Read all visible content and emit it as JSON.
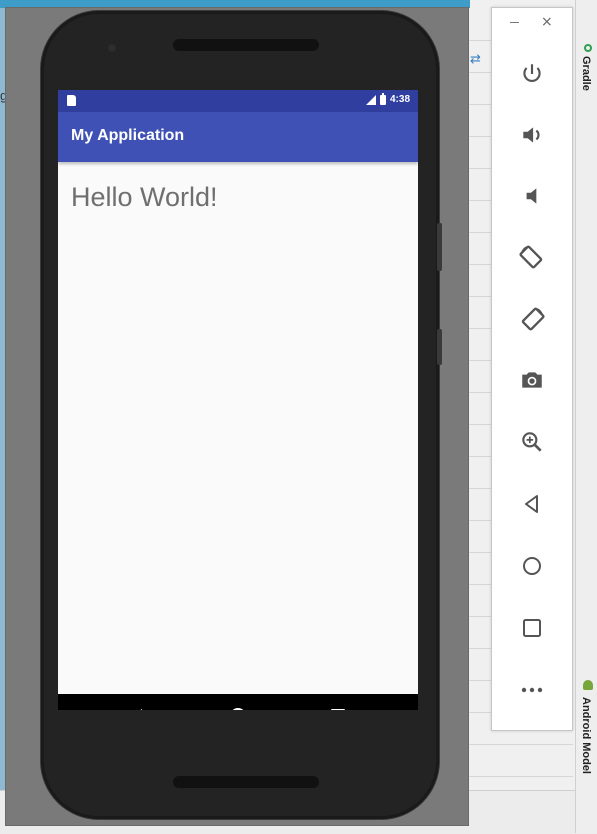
{
  "emulator": {
    "status_bar": {
      "time": "4:38",
      "icons": [
        "sd-card-icon",
        "signal-icon",
        "battery-icon"
      ]
    },
    "app_bar": {
      "title": "My Application",
      "color": "#3f51b5",
      "status_color": "#303f9f"
    },
    "content": {
      "text": "Hello World!"
    },
    "nav_bar": {
      "buttons": [
        "back-icon",
        "home-icon",
        "recents-icon"
      ]
    }
  },
  "tool_panel": {
    "window_controls": {
      "minimize": "–",
      "close": "×"
    },
    "tools": [
      {
        "icon": "power-icon"
      },
      {
        "icon": "volume-up-icon"
      },
      {
        "icon": "volume-down-icon"
      },
      {
        "icon": "rotate-left-icon"
      },
      {
        "icon": "rotate-right-icon"
      },
      {
        "icon": "camera-icon"
      },
      {
        "icon": "zoom-icon"
      },
      {
        "icon": "back-icon"
      },
      {
        "icon": "home-icon"
      },
      {
        "icon": "overview-icon"
      },
      {
        "icon": "more-icon"
      }
    ]
  },
  "ide": {
    "right_tabs": {
      "gradle": "Gradle",
      "android_model": "Android Model"
    },
    "left_fragment": "g"
  }
}
